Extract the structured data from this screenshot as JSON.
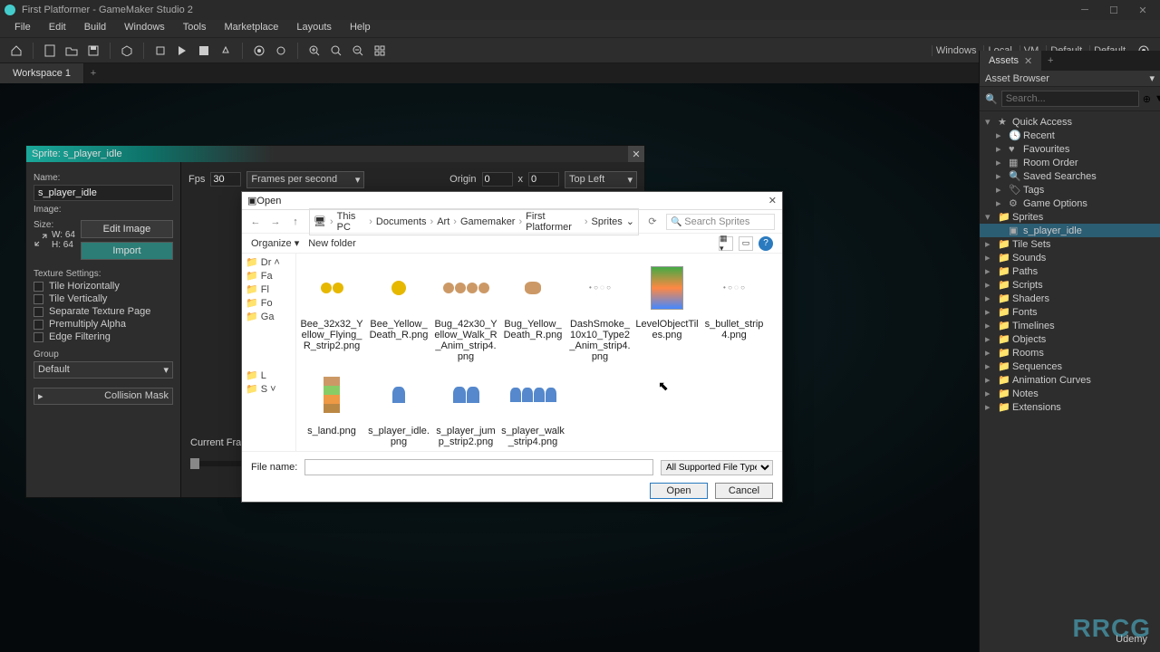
{
  "window": {
    "title": "First Platformer - GameMaker Studio 2"
  },
  "menu": [
    "File",
    "Edit",
    "Build",
    "Windows",
    "Tools",
    "Marketplace",
    "Layouts",
    "Help"
  ],
  "status_right": {
    "windows": "Windows",
    "local": "Local",
    "vm": "VM",
    "default1": "Default",
    "default2": "Default"
  },
  "workspace_tab": "Workspace 1",
  "sprite_editor": {
    "title": "Sprite: s_player_idle",
    "name_label": "Name:",
    "name_value": "s_player_idle",
    "image_label": "Image:",
    "size_label": "Size:",
    "w": "W: 64",
    "h": "H: 64",
    "edit_image": "Edit Image",
    "import": "Import",
    "tex_label": "Texture Settings:",
    "tex_opts": [
      "Tile Horizontally",
      "Tile Vertically",
      "Separate Texture Page",
      "Premultiply Alpha",
      "Edge Filtering"
    ],
    "group_label": "Group",
    "group_value": "Default",
    "collision": "Collision Mask",
    "fps_label": "Fps",
    "fps_value": "30",
    "fps_unit": "Frames per second",
    "origin_label": "Origin",
    "origin_x": "0",
    "origin_xlbl": "x",
    "origin_y": "0",
    "origin_mode": "Top Left",
    "current_frame": "Current Fram"
  },
  "assets": {
    "tab": "Assets",
    "browser": "Asset Browser",
    "search_placeholder": "Search...",
    "quick_access": "Quick Access",
    "qa_items": [
      "Recent",
      "Favourites",
      "Room Order",
      "Saved Searches",
      "Tags",
      "Game Options"
    ],
    "folders": [
      "Sprites",
      "Tile Sets",
      "Sounds",
      "Paths",
      "Scripts",
      "Shaders",
      "Fonts",
      "Timelines",
      "Objects",
      "Rooms",
      "Sequences",
      "Animation Curves",
      "Notes",
      "Extensions"
    ],
    "selected_sprite": "s_player_idle"
  },
  "dialog": {
    "title": "Open",
    "crumbs": [
      "This PC",
      "Documents",
      "Art",
      "Gamemaker",
      "First Platformer",
      "Sprites"
    ],
    "search_placeholder": "Search Sprites",
    "organize": "Organize",
    "new_folder": "New folder",
    "side": [
      "Dr",
      "Fa",
      "Fl",
      "Fo",
      "Ga",
      "L",
      "S"
    ],
    "files": [
      "Bee_32x32_Yellow_Flying_R_strip2.png",
      "Bee_Yellow_Death_R.png",
      "Bug_42x30_Yellow_Walk_R_Anim_strip4.png",
      "Bug_Yellow_Death_R.png",
      "DashSmoke_10x10_Type2_Anim_strip4.png",
      "LevelObjectTiles.png",
      "s_bullet_strip4.png",
      "s_land.png",
      "s_player_idle.png",
      "s_player_jump_strip2.png",
      "s_player_walk_strip4.png"
    ],
    "fn_label": "File name:",
    "filter": "All Supported File Types (*.png;",
    "open": "Open",
    "cancel": "Cancel"
  },
  "udemy": "Udemy"
}
